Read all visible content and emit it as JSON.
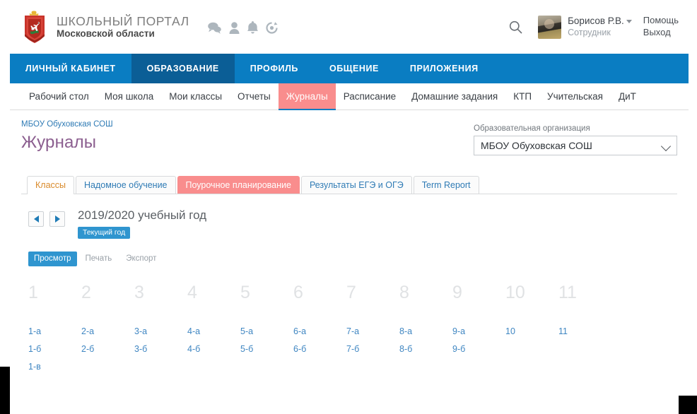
{
  "header": {
    "brand_title": "ШКОЛЬНЫЙ ПОРТАЛ",
    "brand_sub": "Московской области",
    "crest_alt": "coat-of-arms",
    "icons": [
      "messages-icon",
      "contacts-icon",
      "notifications-icon",
      "globe-icon"
    ],
    "search_icon": "search-icon",
    "user": {
      "name": "Борисов Р.В.",
      "role": "Сотрудник"
    },
    "help_label": "Помощь",
    "logout_label": "Выход"
  },
  "mainnav": {
    "items": [
      {
        "label": "ЛИЧНЫЙ КАБИНЕТ",
        "active": false
      },
      {
        "label": "ОБРАЗОВАНИЕ",
        "active": true
      },
      {
        "label": "ПРОФИЛЬ",
        "active": false
      },
      {
        "label": "ОБЩЕНИЕ",
        "active": false
      },
      {
        "label": "ПРИЛОЖЕНИЯ",
        "active": false
      }
    ]
  },
  "subnav": {
    "items": [
      {
        "label": "Рабочий стол",
        "highlighted": false
      },
      {
        "label": "Моя школа",
        "highlighted": false
      },
      {
        "label": "Мои классы",
        "highlighted": false
      },
      {
        "label": "Отчеты",
        "highlighted": false
      },
      {
        "label": "Журналы",
        "highlighted": true
      },
      {
        "label": "Расписание",
        "highlighted": false
      },
      {
        "label": "Домашние задания",
        "highlighted": false
      },
      {
        "label": "КТП",
        "highlighted": false
      },
      {
        "label": "Учительская",
        "highlighted": false
      },
      {
        "label": "ДиТ",
        "highlighted": false
      }
    ]
  },
  "content": {
    "breadcrumb": "МБОУ Обуховская СОШ",
    "page_title": "Журналы",
    "org": {
      "label": "Образовательная организация",
      "selected": "МБОУ Обуховская СОШ"
    },
    "tabs": [
      {
        "label": "Классы",
        "state": "active"
      },
      {
        "label": "Надомное обучение",
        "state": "normal"
      },
      {
        "label": "Поурочное планирование",
        "state": "highlighted"
      },
      {
        "label": "Результаты ЕГЭ и ОГЭ",
        "state": "normal"
      },
      {
        "label": "Term Report",
        "state": "normal"
      }
    ],
    "year": {
      "prev_icon": "arrow-left-icon",
      "next_icon": "arrow-right-icon",
      "title": "2019/2020 учебный год",
      "badge": "Текущий год"
    },
    "actions": [
      {
        "label": "Просмотр",
        "state": "active"
      },
      {
        "label": "Печать",
        "state": "plain"
      },
      {
        "label": "Экспорт",
        "state": "plain"
      }
    ],
    "grid": {
      "columns": [
        {
          "head": "1",
          "classes": [
            "1-а",
            "1-б",
            "1-в"
          ]
        },
        {
          "head": "2",
          "classes": [
            "2-а",
            "2-б"
          ]
        },
        {
          "head": "3",
          "classes": [
            "3-а",
            "3-б"
          ]
        },
        {
          "head": "4",
          "classes": [
            "4-а",
            "4-б"
          ]
        },
        {
          "head": "5",
          "classes": [
            "5-а",
            "5-б"
          ]
        },
        {
          "head": "6",
          "classes": [
            "6-а",
            "6-б"
          ]
        },
        {
          "head": "7",
          "classes": [
            "7-а",
            "7-б"
          ]
        },
        {
          "head": "8",
          "classes": [
            "8-а",
            "8-б"
          ]
        },
        {
          "head": "9",
          "classes": [
            "9-а",
            "9-б"
          ]
        },
        {
          "head": "10",
          "classes": [
            "10"
          ]
        },
        {
          "head": "11",
          "classes": [
            "11"
          ]
        }
      ]
    }
  },
  "colors": {
    "nav_blue": "#0a7dc2",
    "nav_blue_active": "#0b5e96",
    "highlight_pink": "#f98d8d",
    "link_blue": "#3f86c2",
    "title_purple": "#8b5e8f",
    "tab_active_orange": "#d98a2b",
    "badge_blue": "#2f95cf"
  }
}
